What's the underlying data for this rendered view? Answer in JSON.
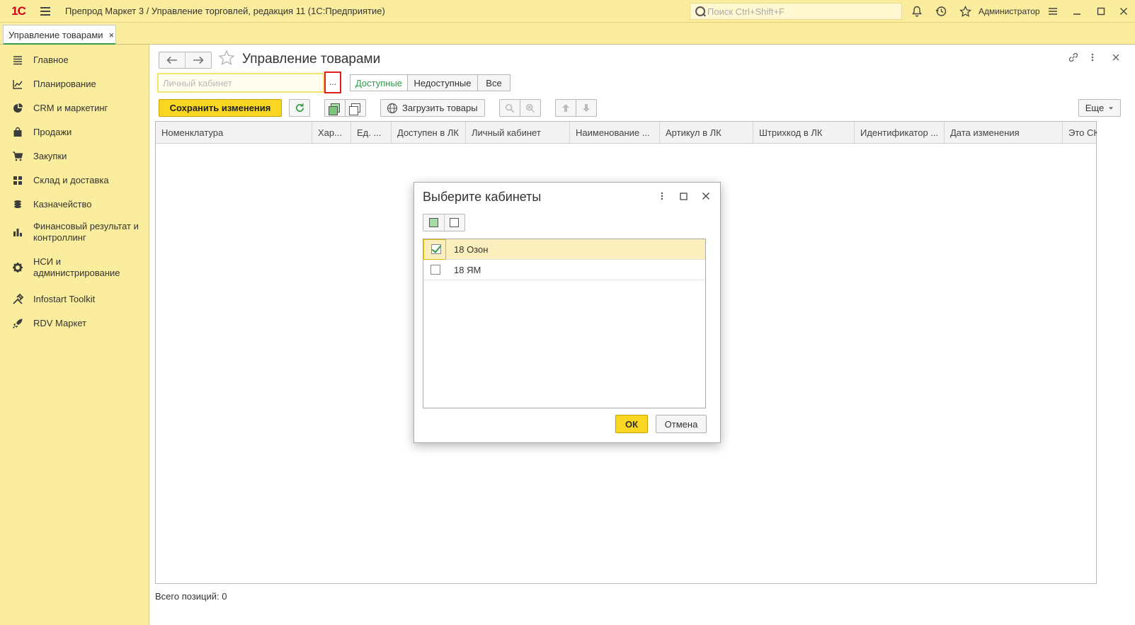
{
  "titlebar": {
    "logo": "1С",
    "title": "Препрод Маркет 3 / Управление торговлей, редакция 11  (1С:Предприятие)",
    "search_placeholder": "Поиск Ctrl+Shift+F",
    "user": "Администратор"
  },
  "tabs": [
    {
      "label": "Управление товарами",
      "close": "×"
    }
  ],
  "sidebar": {
    "items": [
      {
        "label": "Главное",
        "icon": "menu-lines-icon"
      },
      {
        "label": "Планирование",
        "icon": "planning-chart-icon"
      },
      {
        "label": "CRM и маркетинг",
        "icon": "pie-chart-icon"
      },
      {
        "label": "Продажи",
        "icon": "shopping-bag-icon"
      },
      {
        "label": "Закупки",
        "icon": "shopping-cart-icon"
      },
      {
        "label": "Склад и доставка",
        "icon": "warehouse-grid-icon"
      },
      {
        "label": "Казначейство",
        "icon": "coins-icon"
      },
      {
        "label": "Финансовый результат и контроллинг",
        "icon": "bar-chart-icon"
      },
      {
        "label": "НСИ и администрирование",
        "icon": "gear-icon"
      },
      {
        "label": "Infostart Toolkit",
        "icon": "tools-icon"
      },
      {
        "label": "RDV Маркет",
        "icon": "rocket-icon"
      }
    ]
  },
  "form": {
    "title": "Управление товарами",
    "lk_placeholder": "Личный кабинет",
    "dots": "...",
    "filter": [
      "Доступные",
      "Недоступные",
      "Все"
    ],
    "save_label": "Сохранить изменения",
    "load_label": "Загрузить товары",
    "more_label": "Еще",
    "columns": [
      "Номенклатура",
      "Хар...",
      "Ед. ...",
      "Доступен в ЛК",
      "Личный кабинет",
      "Наименование ...",
      "Артикул в ЛК",
      "Штрихкод в ЛК",
      "Идентификатор ...",
      "Дата изменения",
      "Это СКГТ"
    ],
    "total_label": "Всего позиций:",
    "total_value": "0"
  },
  "dialog": {
    "title": "Выберите кабинеты",
    "rows": [
      {
        "label": "18 Озон",
        "checked": true
      },
      {
        "label": "18 ЯМ",
        "checked": false
      }
    ],
    "ok_label": "ОК",
    "cancel_label": "Отмена"
  }
}
